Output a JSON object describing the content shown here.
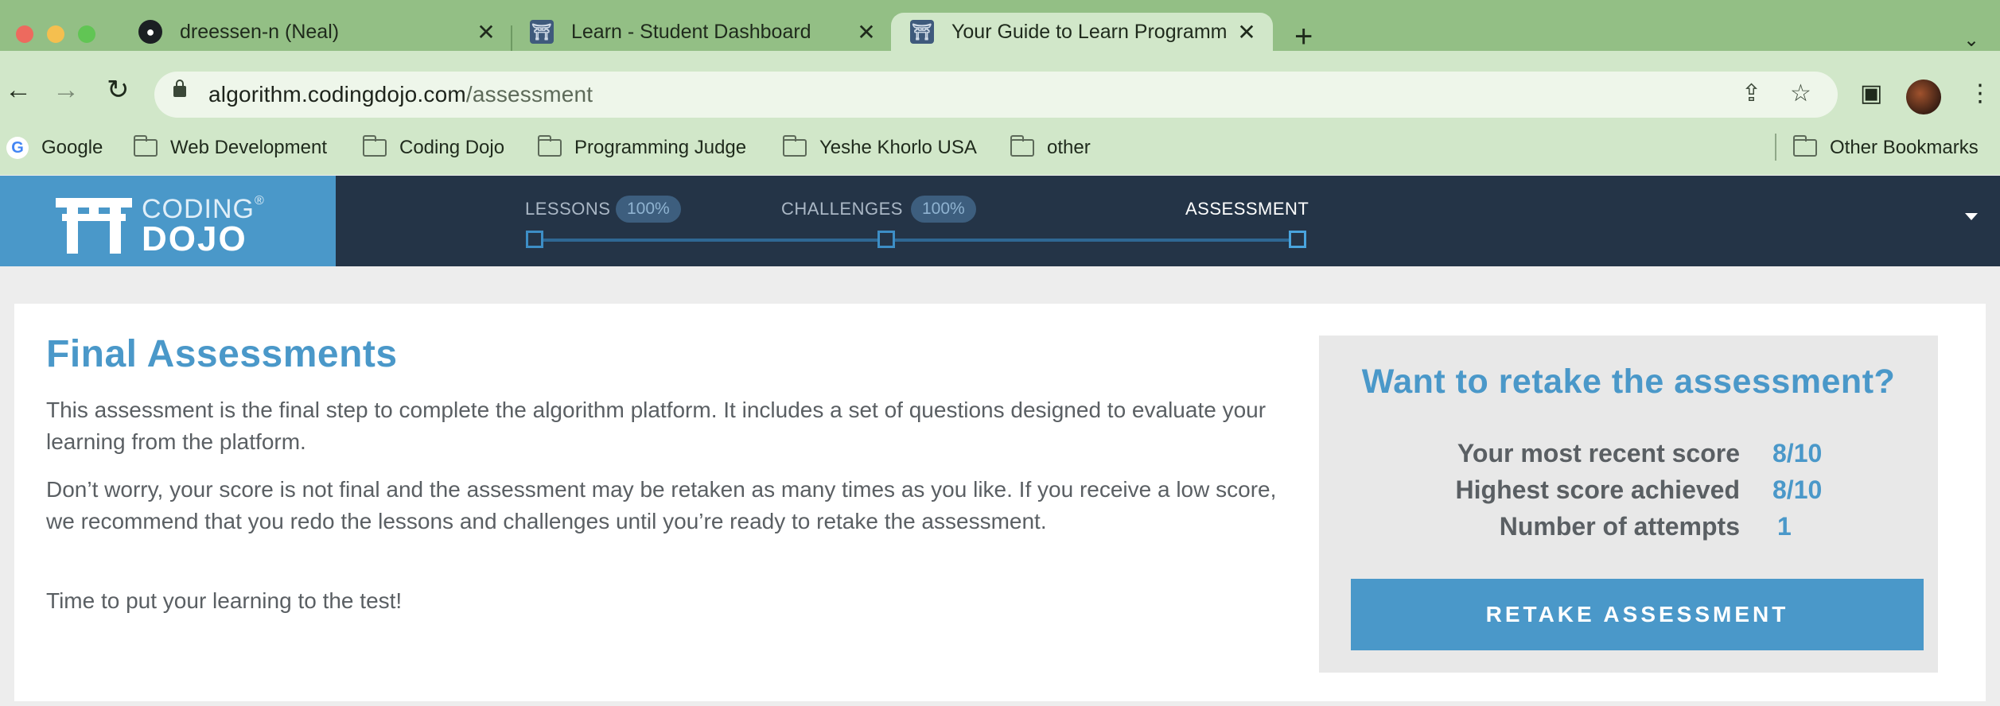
{
  "browser": {
    "tabs": [
      {
        "title": "dreessen-n (Neal)",
        "favicon": "github-icon",
        "active": false
      },
      {
        "title": "Learn - Student Dashboard",
        "favicon": "coding-dojo-icon",
        "active": false
      },
      {
        "title": "Your Guide to Learn Programm",
        "favicon": "coding-dojo-icon",
        "active": true
      }
    ],
    "close_glyph": "✕",
    "new_tab_glyph": "+",
    "url_host": "algorithm.codingdojo.com",
    "url_path": "/assessment",
    "bookmarks": [
      {
        "label": "Google",
        "icon": "google-icon"
      },
      {
        "label": "Web Development",
        "icon": "folder-icon"
      },
      {
        "label": "Coding Dojo",
        "icon": "folder-icon"
      },
      {
        "label": "Programming Judge",
        "icon": "folder-icon"
      },
      {
        "label": "Yeshe Khorlo USA",
        "icon": "folder-icon"
      },
      {
        "label": "other",
        "icon": "folder-icon"
      }
    ],
    "other_bookmarks": "Other Bookmarks"
  },
  "header": {
    "logo_top": "CODING",
    "logo_reg": "®",
    "logo_bottom": "DOJO",
    "steps": [
      {
        "label": "LESSONS",
        "badge": "100%"
      },
      {
        "label": "CHALLENGES",
        "badge": "100%"
      },
      {
        "label": "ASSESSMENT",
        "badge": ""
      }
    ]
  },
  "main": {
    "title": "Final Assessments",
    "paragraphs": [
      "This assessment is the final step to complete the algorithm platform. It includes a set of questions designed to evaluate your learning from the platform.",
      "Don’t worry, your score is not final and the assessment may be retaken as many times as you like. If you receive a low score, we recommend that you redo the lessons and challenges until you’re ready to retake the assessment.",
      "Time to put your learning to the test!"
    ]
  },
  "retake_panel": {
    "title": "Want to retake the assessment?",
    "stats": [
      {
        "label": "Your most recent score",
        "value": "8/10"
      },
      {
        "label": "Highest score achieved",
        "value": "8/10"
      },
      {
        "label": "Number of attempts",
        "value": "1"
      }
    ],
    "button_label": "RETAKE ASSESSMENT"
  },
  "colors": {
    "brand_blue": "#4a98c9",
    "header_navy": "#243447",
    "chrome_green": "#93bf85"
  }
}
